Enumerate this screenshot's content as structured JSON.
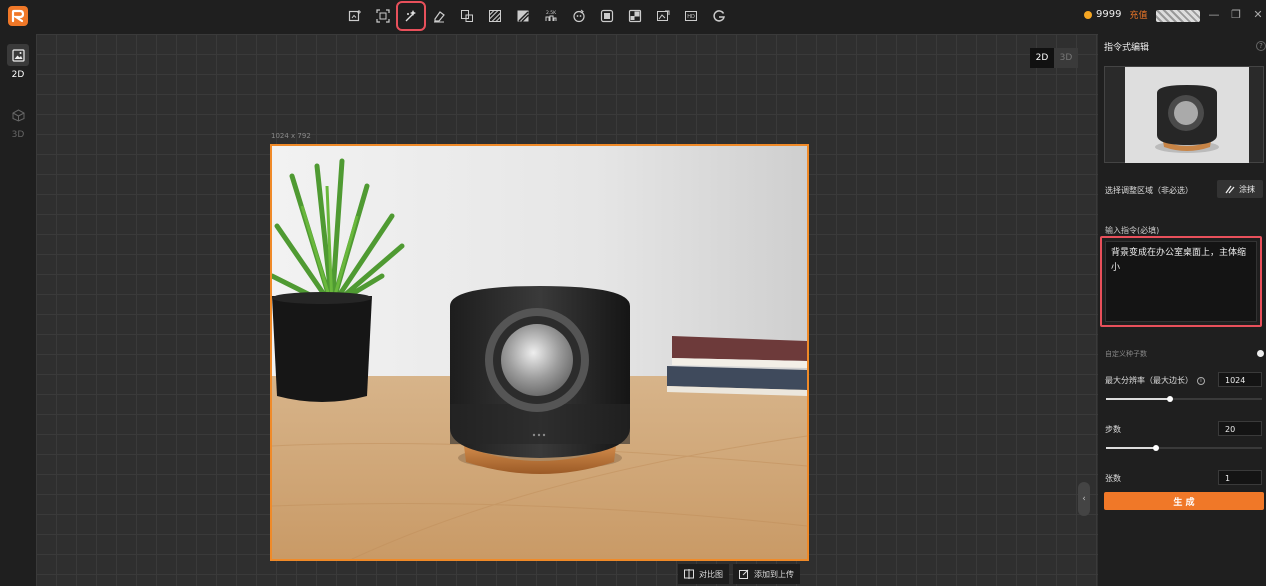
{
  "topbar": {
    "tools": [
      {
        "name": "add-image-icon"
      },
      {
        "name": "crop-scan-icon"
      },
      {
        "name": "command-edit-icon",
        "active": true
      },
      {
        "name": "eraser-icon"
      },
      {
        "name": "replace-icon"
      },
      {
        "name": "pattern-icon"
      },
      {
        "name": "stripe-icon"
      },
      {
        "name": "upscale-icon",
        "label": "2.5K"
      },
      {
        "name": "rotate-icon"
      },
      {
        "name": "layer-icon"
      },
      {
        "name": "expand-icon"
      },
      {
        "name": "image-edit-icon"
      },
      {
        "name": "hd-icon",
        "label": "HD"
      },
      {
        "name": "g-icon",
        "label": "G"
      }
    ],
    "coins": "9999",
    "recharge": "充值"
  },
  "sidebar": {
    "items": [
      {
        "label": "2D",
        "icon": "image-icon"
      },
      {
        "label": "3D",
        "icon": "cube-icon"
      }
    ]
  },
  "canvas": {
    "dim_2d": "2D",
    "dim_3d": "3D",
    "image_size": "1024 x 792",
    "compare_label": "对比图",
    "add_upload_label": "添加到上传"
  },
  "panel": {
    "title": "指令式编辑",
    "select_area_label": "选择调整区域（非必选）",
    "brush_label": "涂抹",
    "command_label": "输入指令(必填)",
    "command_value": "背景变成在办公室桌面上，主体缩小",
    "seed_label": "自定义种子数",
    "resolution_label": "最大分辨率（最大边长）",
    "resolution_value": "1024",
    "resolution_level": 0.41,
    "steps_label": "步数",
    "steps_value": "20",
    "steps_level": 0.32,
    "count_label": "张数",
    "count_value": "1",
    "generate_label": "生 成"
  },
  "colors": {
    "accent": "#f07828",
    "highlight": "#e8505b"
  }
}
